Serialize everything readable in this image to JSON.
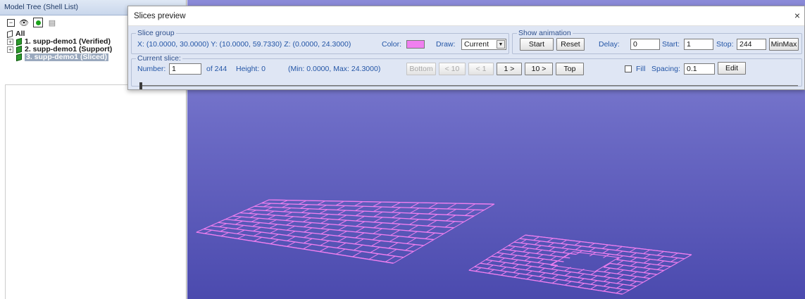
{
  "tree": {
    "header": "Model Tree (Shell List)",
    "items": [
      {
        "label": "All",
        "expander": ""
      },
      {
        "label": "1. supp-demo1 (Verified)",
        "expander": "+"
      },
      {
        "label": "2. supp-demo1 (Support)",
        "expander": "+"
      },
      {
        "label": "3. supp-demo1 (Sliced)",
        "expander": ""
      }
    ],
    "toolbar_icons": [
      "collapse-icon",
      "eye-icon",
      "green-dot-icon",
      "layers-icon"
    ]
  },
  "dialog": {
    "title": "Slices preview",
    "close": "×",
    "slice_group": {
      "title": "Slice group",
      "coords": "X: (10.0000,  30.0000)  Y: (10.0000,  59.7330)  Z: (0.0000,  24.3000)",
      "color_label": "Color:",
      "color": "#f07ff0",
      "draw_label": "Draw:",
      "draw_value": "Current"
    },
    "animation": {
      "title": "Show animation",
      "start_button": "Start",
      "reset_button": "Reset",
      "delay_label": "Delay:",
      "delay_value": "0",
      "start_label": "Start:",
      "start_value": "1",
      "stop_label": "Stop:",
      "stop_value": "244",
      "minmax_button": "MinMax"
    },
    "current_slice": {
      "title": "Current slice:",
      "number_label": "Number:",
      "number_value": "1",
      "of_text": "of 244",
      "height_text": "Height:  0",
      "range_text": "(Min: 0.0000, Max: 24.3000)",
      "buttons": {
        "bottom": "Bottom",
        "minus10": "< 10",
        "minus1": "< 1",
        "plus1": "1 >",
        "plus10": "10 >",
        "top": "Top"
      },
      "fill_label": "Fill",
      "spacing_label": "Spacing:",
      "spacing_value": "0.1",
      "edit_button": "Edit",
      "slider_fraction": 0.0
    }
  },
  "viewport": {
    "background_top": "#8b8bd8",
    "background_bottom": "#4b4aae",
    "slice_color": "#f07ff0"
  }
}
